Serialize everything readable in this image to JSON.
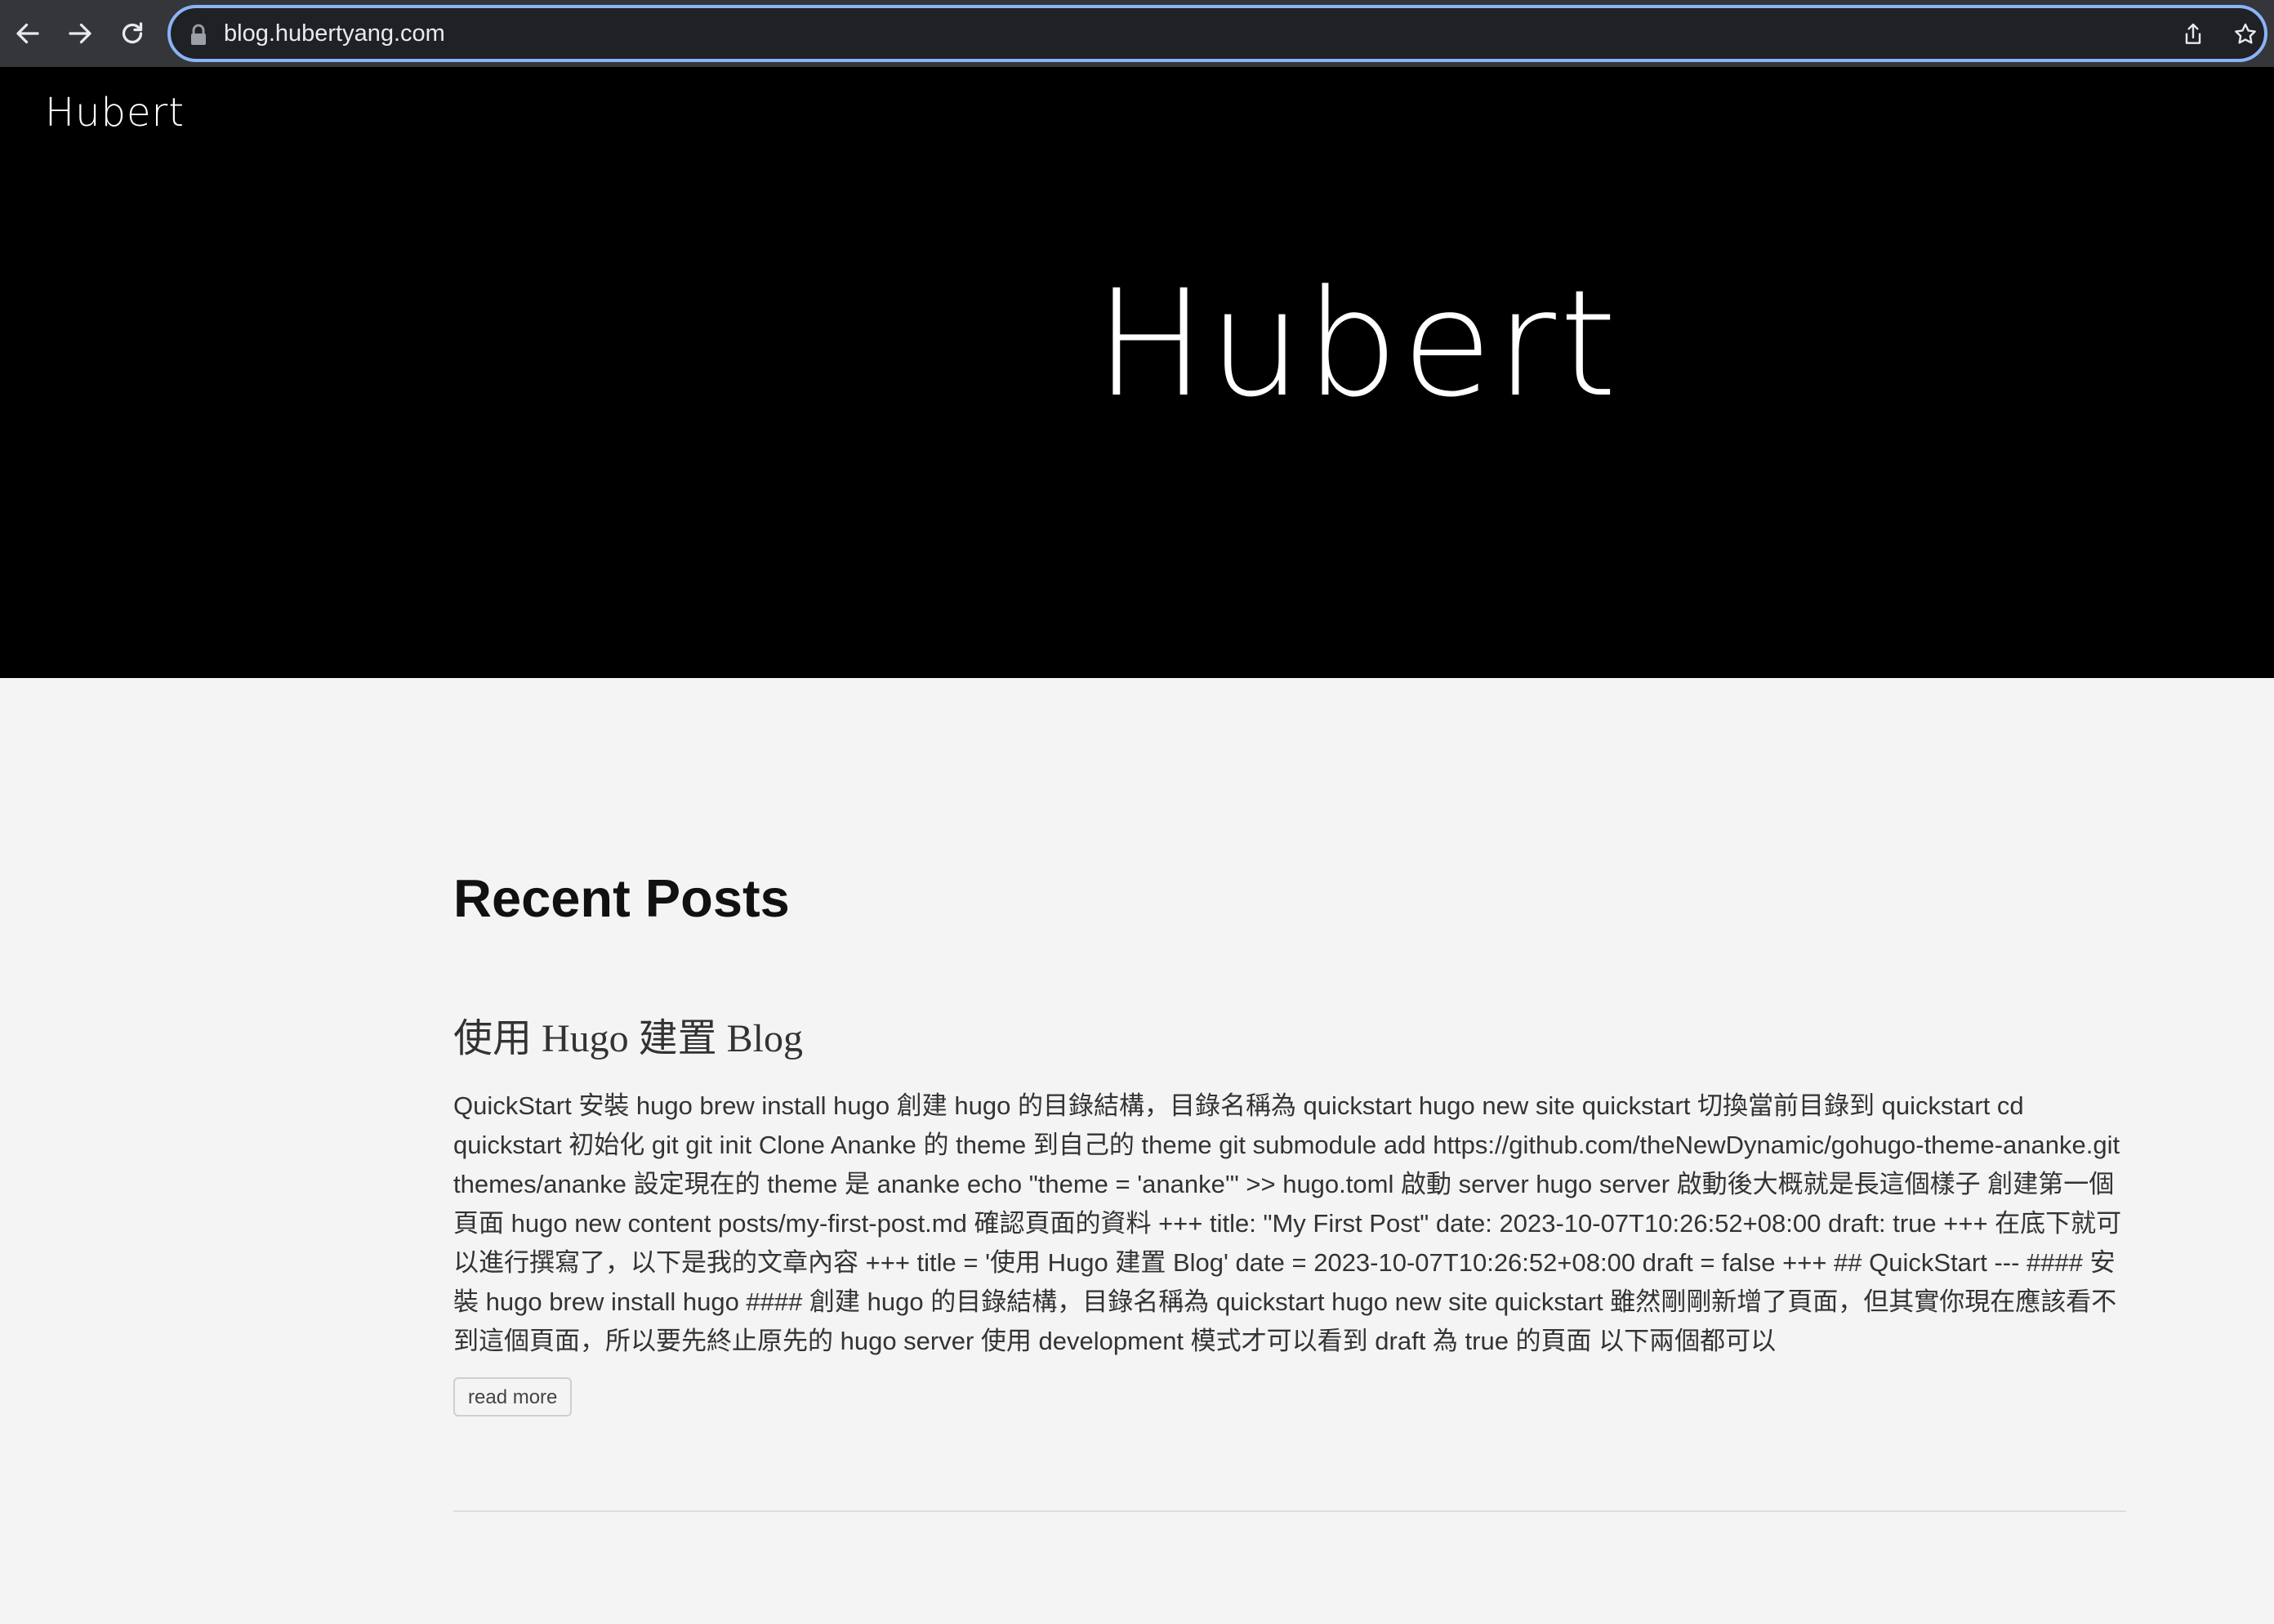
{
  "browser": {
    "url": "blog.hubertyang.com",
    "icons": {
      "back": "arrow-left-icon",
      "forward": "arrow-right-icon",
      "reload": "reload-icon",
      "lock": "lock-icon",
      "share": "share-icon",
      "bookmark": "star-icon"
    },
    "accent_color": "#8ab4f8"
  },
  "site": {
    "logo": "Hubert",
    "hero_title": "Hubert"
  },
  "main": {
    "section_heading": "Recent Posts",
    "posts": [
      {
        "title": "使用 Hugo 建置 Blog",
        "summary": "QuickStart 安裝 hugo brew install hugo 創建 hugo 的目錄結構，目錄名稱為 quickstart hugo new site quickstart 切換當前目錄到 quickstart cd quickstart 初始化 git git init Clone Ananke 的 theme 到自己的 theme git submodule add https://github.com/theNewDynamic/gohugo-theme-ananke.git themes/ananke 設定現在的 theme 是 ananke echo \"theme = 'ananke'\" >> hugo.toml 啟動 server hugo server 啟動後大概就是長這個樣子 創建第一個頁面 hugo new content posts/my-first-post.md 確認頁面的資料 +++ title: \"My First Post\" date: 2023-10-07T10:26:52+08:00 draft: true +++ 在底下就可以進行撰寫了，以下是我的文章內容 +++ title = '使用 Hugo 建置 Blog' date = 2023-10-07T10:26:52+08:00 draft = false +++ ## QuickStart --- #### 安裝 hugo brew install hugo #### 創建 hugo 的目錄結構，目錄名稱為 quickstart hugo new site quickstart 雖然剛剛新增了頁面，但其實你現在應該看不到這個頁面，所以要先終止原先的 hugo server 使用 development 模式才可以看到 draft 為 true 的頁面 以下兩個都可以",
        "read_more": "read more"
      }
    ]
  }
}
